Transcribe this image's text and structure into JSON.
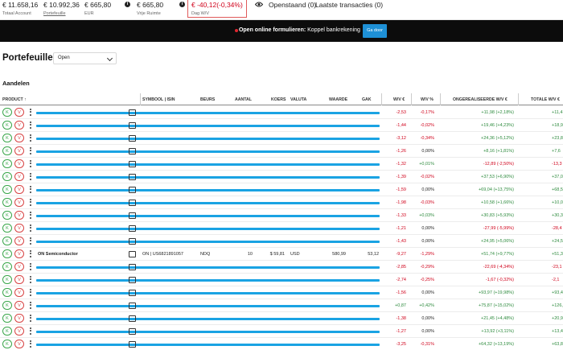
{
  "summary": {
    "total_account": {
      "value": "€ 11.658,16",
      "label": "Totaal Account"
    },
    "portfolio": {
      "value": "€ 10.992,36",
      "label": "Portefeuille"
    },
    "eur": {
      "value": "€ 665,80",
      "label": "EUR"
    },
    "free_space": {
      "value": "€ 665,80",
      "label": "Vrije Ruimte"
    },
    "day_pl": {
      "value": "€ -40,12(-0,34%)",
      "label": "Dag W/V"
    },
    "open_orders": "Openstaand (0)",
    "last_transactions": "Laatste transacties (0)"
  },
  "banner": {
    "bold": "Open online formulieren:",
    "text": "Koppel bankrekening",
    "button": "Ga door"
  },
  "page": {
    "title": "Portefeuille",
    "filter_value": "Open",
    "section": "Aandelen"
  },
  "table": {
    "columns": {
      "product": "PRODUCT",
      "sort_indicator": "↑",
      "symbol": "SYMBOOL | ISIN",
      "exchange": "BEURS",
      "quantity": "AANTAL",
      "price": "KOERS",
      "currency": "VALUTA",
      "value": "WAARDE",
      "gak": "GAK",
      "pl": "W/V €",
      "pl_pct": "W/V %",
      "unrealized": "ONGEREALISEERDE W/V €",
      "total_pl": "TOTALE W/V €"
    },
    "buy_label": "K",
    "sell_label": "V",
    "rows": [
      {
        "redacted": true,
        "pl": "-2,53",
        "pl_pct": "-0,17%",
        "unrealized": "+11,98 (+2,18%)",
        "total": "+11,4",
        "s1": "neg",
        "s2": "neg",
        "s3": "pos"
      },
      {
        "redacted": true,
        "pl": "-1,44",
        "pl_pct": "-0,02%",
        "unrealized": "+19,46 (+4,23%)",
        "total": "+18,9",
        "s1": "neg",
        "s2": "neg",
        "s3": "pos"
      },
      {
        "redacted": true,
        "pl": "-3,12",
        "pl_pct": "-0,34%",
        "unrealized": "+24,36 (+5,12%)",
        "total": "+23,8",
        "s1": "neg",
        "s2": "neg",
        "s3": "pos"
      },
      {
        "redacted": true,
        "pl": "-1,26",
        "pl_pct": "0,00%",
        "unrealized": "+8,16 (+1,81%)",
        "total": "+7,6",
        "s1": "neg",
        "s2": "neu",
        "s3": "pos"
      },
      {
        "redacted": true,
        "pl": "-1,32",
        "pl_pct": "+0,01%",
        "unrealized": "-12,89 (-2,50%)",
        "total": "-13,3",
        "s1": "neg",
        "s2": "pos",
        "s3": "neg"
      },
      {
        "redacted": true,
        "pl": "-1,39",
        "pl_pct": "-0,02%",
        "unrealized": "+37,53 (+6,90%)",
        "total": "+37,0",
        "s1": "neg",
        "s2": "neg",
        "s3": "pos"
      },
      {
        "redacted": true,
        "pl": "-1,59",
        "pl_pct": "0,00%",
        "unrealized": "+69,04 (+13,75%)",
        "total": "+68,5",
        "s1": "neg",
        "s2": "neu",
        "s3": "pos"
      },
      {
        "redacted": true,
        "pl": "-1,98",
        "pl_pct": "-0,03%",
        "unrealized": "+10,58 (+1,66%)",
        "total": "+10,0",
        "s1": "neg",
        "s2": "neg",
        "s3": "pos"
      },
      {
        "redacted": true,
        "pl": "-1,33",
        "pl_pct": "+0,03%",
        "unrealized": "+30,83 (+5,93%)",
        "total": "+30,3",
        "s1": "neg",
        "s2": "pos",
        "s3": "pos"
      },
      {
        "redacted": true,
        "pl": "-1,21",
        "pl_pct": "0,00%",
        "unrealized": "-27,99 (-5,99%)",
        "total": "-28,4",
        "s1": "neg",
        "s2": "neu",
        "s3": "neg"
      },
      {
        "redacted": true,
        "pl": "-1,43",
        "pl_pct": "0,00%",
        "unrealized": "+24,95 (+5,06%)",
        "total": "+24,5",
        "s1": "neg",
        "s2": "neu",
        "s3": "pos"
      },
      {
        "redacted": false,
        "name": "ON Semiconductor",
        "symbol": "ON | US6821891057",
        "exchange": "NDQ",
        "quantity": "10",
        "price": "$ 59,81",
        "currency": "USD",
        "value": "580,99",
        "gak": "53,12",
        "pl": "-9,27",
        "pl_pct": "-1,29%",
        "unrealized": "+51,74 (+9,77%)",
        "total": "+51,3",
        "s1": "neg",
        "s2": "neg",
        "s3": "pos"
      },
      {
        "redacted": true,
        "pl": "-2,85",
        "pl_pct": "-0,29%",
        "unrealized": "-22,69 (-4,34%)",
        "total": "-23,1",
        "s1": "neg",
        "s2": "neg",
        "s3": "neg"
      },
      {
        "redacted": true,
        "pl": "-2,74",
        "pl_pct": "-0,25%",
        "unrealized": "-1,67 (-0,32%)",
        "total": "-2,1",
        "s1": "neg",
        "s2": "neg",
        "s3": "neg"
      },
      {
        "redacted": true,
        "pl": "-1,56",
        "pl_pct": "0,00%",
        "unrealized": "+93,97 (+19,98%)",
        "total": "+93,4",
        "s1": "neg",
        "s2": "neu",
        "s3": "pos"
      },
      {
        "redacted": true,
        "pl": "+0,87",
        "pl_pct": "+0,42%",
        "unrealized": "+75,87 (+15,02%)",
        "total": "+126,3",
        "s1": "pos",
        "s2": "pos",
        "s3": "pos"
      },
      {
        "redacted": true,
        "pl": "-1,38",
        "pl_pct": "0,00%",
        "unrealized": "+21,45 (+4,48%)",
        "total": "+20,9",
        "s1": "neg",
        "s2": "neu",
        "s3": "pos"
      },
      {
        "redacted": true,
        "pl": "-1,27",
        "pl_pct": "0,00%",
        "unrealized": "+13,92 (+3,11%)",
        "total": "+13,4",
        "s1": "neg",
        "s2": "neu",
        "s3": "pos"
      },
      {
        "redacted": true,
        "pl": "-3,25",
        "pl_pct": "-0,31%",
        "unrealized": "+64,32 (+13,19%)",
        "total": "+63,8",
        "s1": "neg",
        "s2": "neg",
        "s3": "pos"
      }
    ]
  },
  "colors": {
    "positive": "#2e8b3e",
    "negative": "#d0021b",
    "accent_button": "#1e90d6",
    "redaction_bar": "#1aa3e3",
    "banner_bg": "#0c0c0c"
  },
  "icons": {
    "info": "info-icon",
    "eye": "eye-icon",
    "menu": "more-vertical-icon",
    "chart": "chart-icon",
    "dropdown": "chevron-down-icon"
  }
}
